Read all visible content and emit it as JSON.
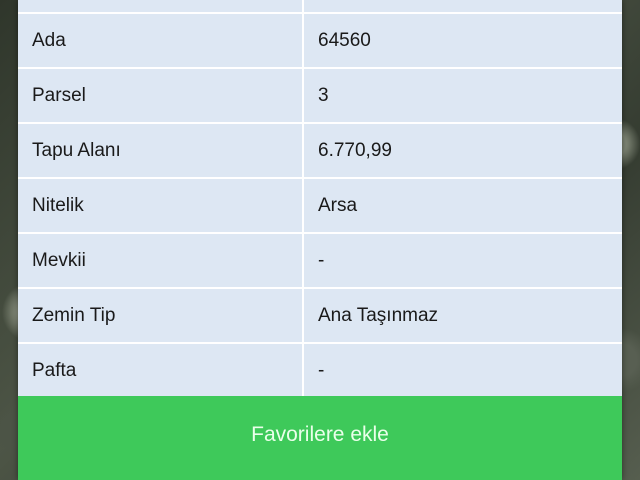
{
  "property": {
    "rows": [
      {
        "label": "Ada",
        "value": "64560"
      },
      {
        "label": "Parsel",
        "value": "3"
      },
      {
        "label": "Tapu Alanı",
        "value": "6.770,99"
      },
      {
        "label": "Nitelik",
        "value": "Arsa"
      },
      {
        "label": "Mevkii",
        "value": "-"
      },
      {
        "label": "Zemin Tip",
        "value": "Ana Taşınmaz"
      },
      {
        "label": "Pafta",
        "value": "-"
      }
    ]
  },
  "actions": {
    "favorite_label": "Favorilere ekle"
  },
  "colors": {
    "panel_bg": "#dde7f3",
    "button_green": "#3ec95a"
  }
}
